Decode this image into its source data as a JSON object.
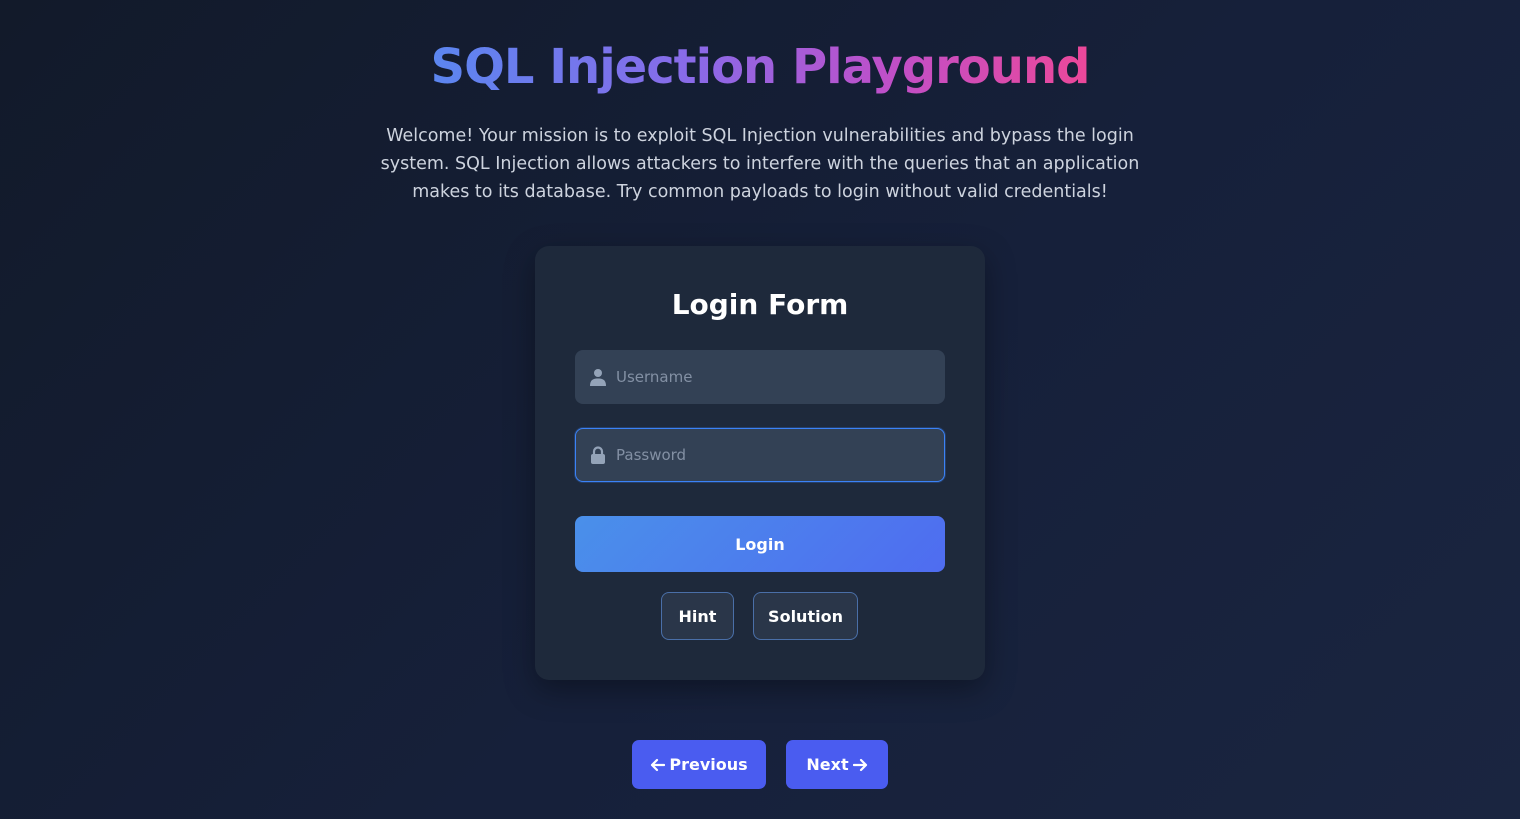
{
  "header": {
    "title": "SQL Injection Playground",
    "intro": "Welcome! Your mission is to exploit SQL Injection vulnerabilities and bypass the login system. SQL Injection allows attackers to interfere with the queries that an application makes to its database. Try common payloads to login without valid credentials!"
  },
  "login_form": {
    "title": "Login Form",
    "username": {
      "placeholder": "Username",
      "value": "",
      "icon": "user-icon"
    },
    "password": {
      "placeholder": "Password",
      "value": "",
      "icon": "lock-icon"
    },
    "login_label": "Login",
    "hint_label": "Hint",
    "solution_label": "Solution"
  },
  "navigation": {
    "previous_label": "Previous",
    "next_label": "Next",
    "previous_icon": "arrow-left-icon",
    "next_icon": "arrow-right-icon"
  },
  "colors": {
    "background": "#141c2e",
    "card": "#1e293b",
    "input": "#334155",
    "accent": "#4a5cf0",
    "title_gradient_start": "#5b86f0",
    "title_gradient_end": "#ec4899"
  }
}
